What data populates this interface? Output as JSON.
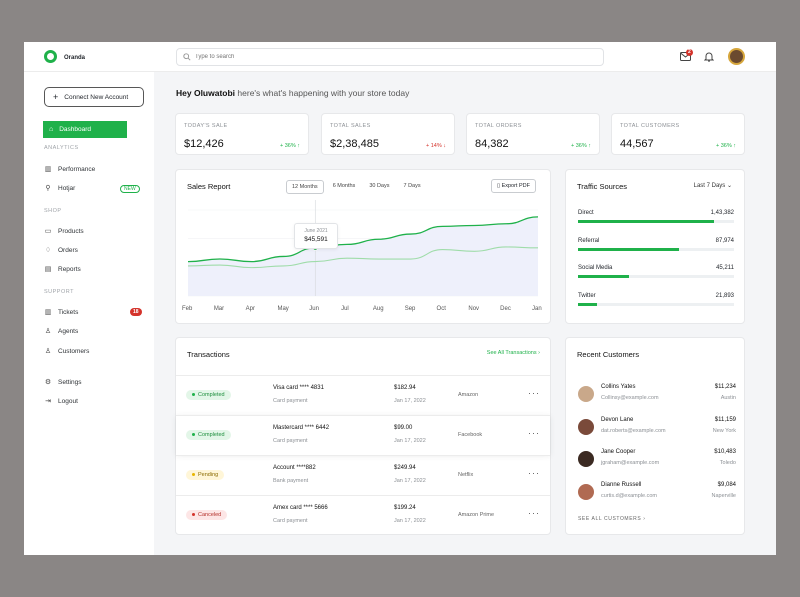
{
  "app": {
    "name": "Oranda"
  },
  "search": {
    "placeholder": "Type to search"
  },
  "notifications": {
    "mail_count": "2"
  },
  "sidebar": {
    "connect_label": "Connect New Account",
    "dashboard_label": "Dashboard",
    "sections": {
      "analytics": "ANALYTICS",
      "shop": "SHOP",
      "support": "SUPPORT"
    },
    "items": {
      "performance": "Performance",
      "hotjar": "Hotjar",
      "hotjar_tag": "NEW",
      "products": "Products",
      "orders": "Orders",
      "reports": "Reports",
      "tickets": "Tickets",
      "tickets_count": "18",
      "agents": "Agents",
      "customers": "Customers",
      "settings": "Settings",
      "logout": "Logout"
    }
  },
  "greeting": {
    "name": "Hey Oluwatobi",
    "message": "here's what's happening with your store today"
  },
  "stats": [
    {
      "label": "TODAY'S SALE",
      "value": "$12,426",
      "change": "+ 36%",
      "arrow": "↑",
      "color": "#1fb14a"
    },
    {
      "label": "TOTAL SALES",
      "value": "$2,38,485",
      "change": "+ 14%",
      "arrow": "↓",
      "color": "#d4332b"
    },
    {
      "label": "TOTAL ORDERS",
      "value": "84,382",
      "change": "+ 36%",
      "arrow": "↑",
      "color": "#1fb14a"
    },
    {
      "label": "TOTAL CUSTOMERS",
      "value": "44,567",
      "change": "+ 36%",
      "arrow": "↑",
      "color": "#1fb14a"
    }
  ],
  "sales_report": {
    "title": "Sales Report",
    "ranges": [
      "12 Months",
      "6 Months",
      "30 Days",
      "7 Days"
    ],
    "active_range": "12 Months",
    "export_label": "Export PDF",
    "tooltip": {
      "date": "June 2021",
      "value": "$45,591"
    }
  },
  "chart_data": {
    "type": "area",
    "title": "",
    "categories": [
      "Feb",
      "Mar",
      "Apr",
      "May",
      "Jun",
      "Jul",
      "Aug",
      "Sep",
      "Oct",
      "Nov",
      "Dec",
      "Jan"
    ],
    "series": [
      {
        "values": [
          0.4,
          0.43,
          0.4,
          0.46,
          0.56,
          0.6,
          0.66,
          0.72,
          0.81,
          0.82,
          0.84,
          0.92
        ]
      },
      {
        "values": [
          0.35,
          0.36,
          0.33,
          0.35,
          0.4,
          0.44,
          0.43,
          0.43,
          0.54,
          0.52,
          0.57,
          0.56
        ]
      }
    ],
    "y_axis_labels_visible": false,
    "highlight": {
      "category": "Jun",
      "label": "June 2021",
      "value": "$45,591"
    },
    "colors": {
      "line_primary": "#1fb14a",
      "line_secondary": "#9fdca9",
      "area_fill": "#eef0fb"
    }
  },
  "traffic_sources": {
    "title": "Traffic Sources",
    "range_label": "Last 7 Days",
    "sources": [
      {
        "name": "Direct",
        "value": "1,43,382",
        "share": 0.87
      },
      {
        "name": "Referral",
        "value": "87,974",
        "share": 0.65
      },
      {
        "name": "Social Media",
        "value": "45,211",
        "share": 0.33
      },
      {
        "name": "Twitter",
        "value": "21,893",
        "share": 0.12
      }
    ]
  },
  "transactions": {
    "title": "Transactions",
    "see_all_label": "See All Transactions",
    "rows": [
      {
        "status": "Completed",
        "method": "Visa card  **** 4831",
        "type": "Card payment",
        "amount": "$182.94",
        "date": "Jan 17, 2022",
        "merchant": "Amazon"
      },
      {
        "status": "Completed",
        "method": "Mastercard  **** 6442",
        "type": "Card payment",
        "amount": "$99.00",
        "date": "Jan 17, 2022",
        "merchant": "Facebook"
      },
      {
        "status": "Pending",
        "method": "Account  ****882",
        "type": "Bank payment",
        "amount": "$249.94",
        "date": "Jan 17, 2022",
        "merchant": "Netflix"
      },
      {
        "status": "Canceled",
        "method": "Amex card  **** 5666",
        "type": "Card payment",
        "amount": "$199.24",
        "date": "Jan 17, 2022",
        "merchant": "Amazon Prime"
      }
    ],
    "status_colors": {
      "Completed": {
        "bg": "#e3f6e8",
        "fg": "#1f8f3e",
        "dot": "#1fb14a"
      },
      "Pending": {
        "bg": "#fff6d8",
        "fg": "#8a6a00",
        "dot": "#e8b500"
      },
      "Canceled": {
        "bg": "#fde6e6",
        "fg": "#b3302a",
        "dot": "#d4332b"
      }
    }
  },
  "recent_customers": {
    "title": "Recent Customers",
    "see_all_label": "SEE ALL CUSTOMERS",
    "customers": [
      {
        "name": "Collins Yates",
        "email": "Collinsy@example.com",
        "amount": "$11,234",
        "city": "Austin",
        "avatar_color": "#c9a88a"
      },
      {
        "name": "Devon Lane",
        "email": "dat.roberts@example.com",
        "amount": "$11,159",
        "city": "New York",
        "avatar_color": "#7a4a3a"
      },
      {
        "name": "Jane Cooper",
        "email": "jgraham@example.com",
        "amount": "$10,483",
        "city": "Toledo",
        "avatar_color": "#3b2a22"
      },
      {
        "name": "Dianne Russell",
        "email": "curtis.d@example.com",
        "amount": "$9,084",
        "city": "Naperville",
        "avatar_color": "#b06a52"
      }
    ]
  }
}
